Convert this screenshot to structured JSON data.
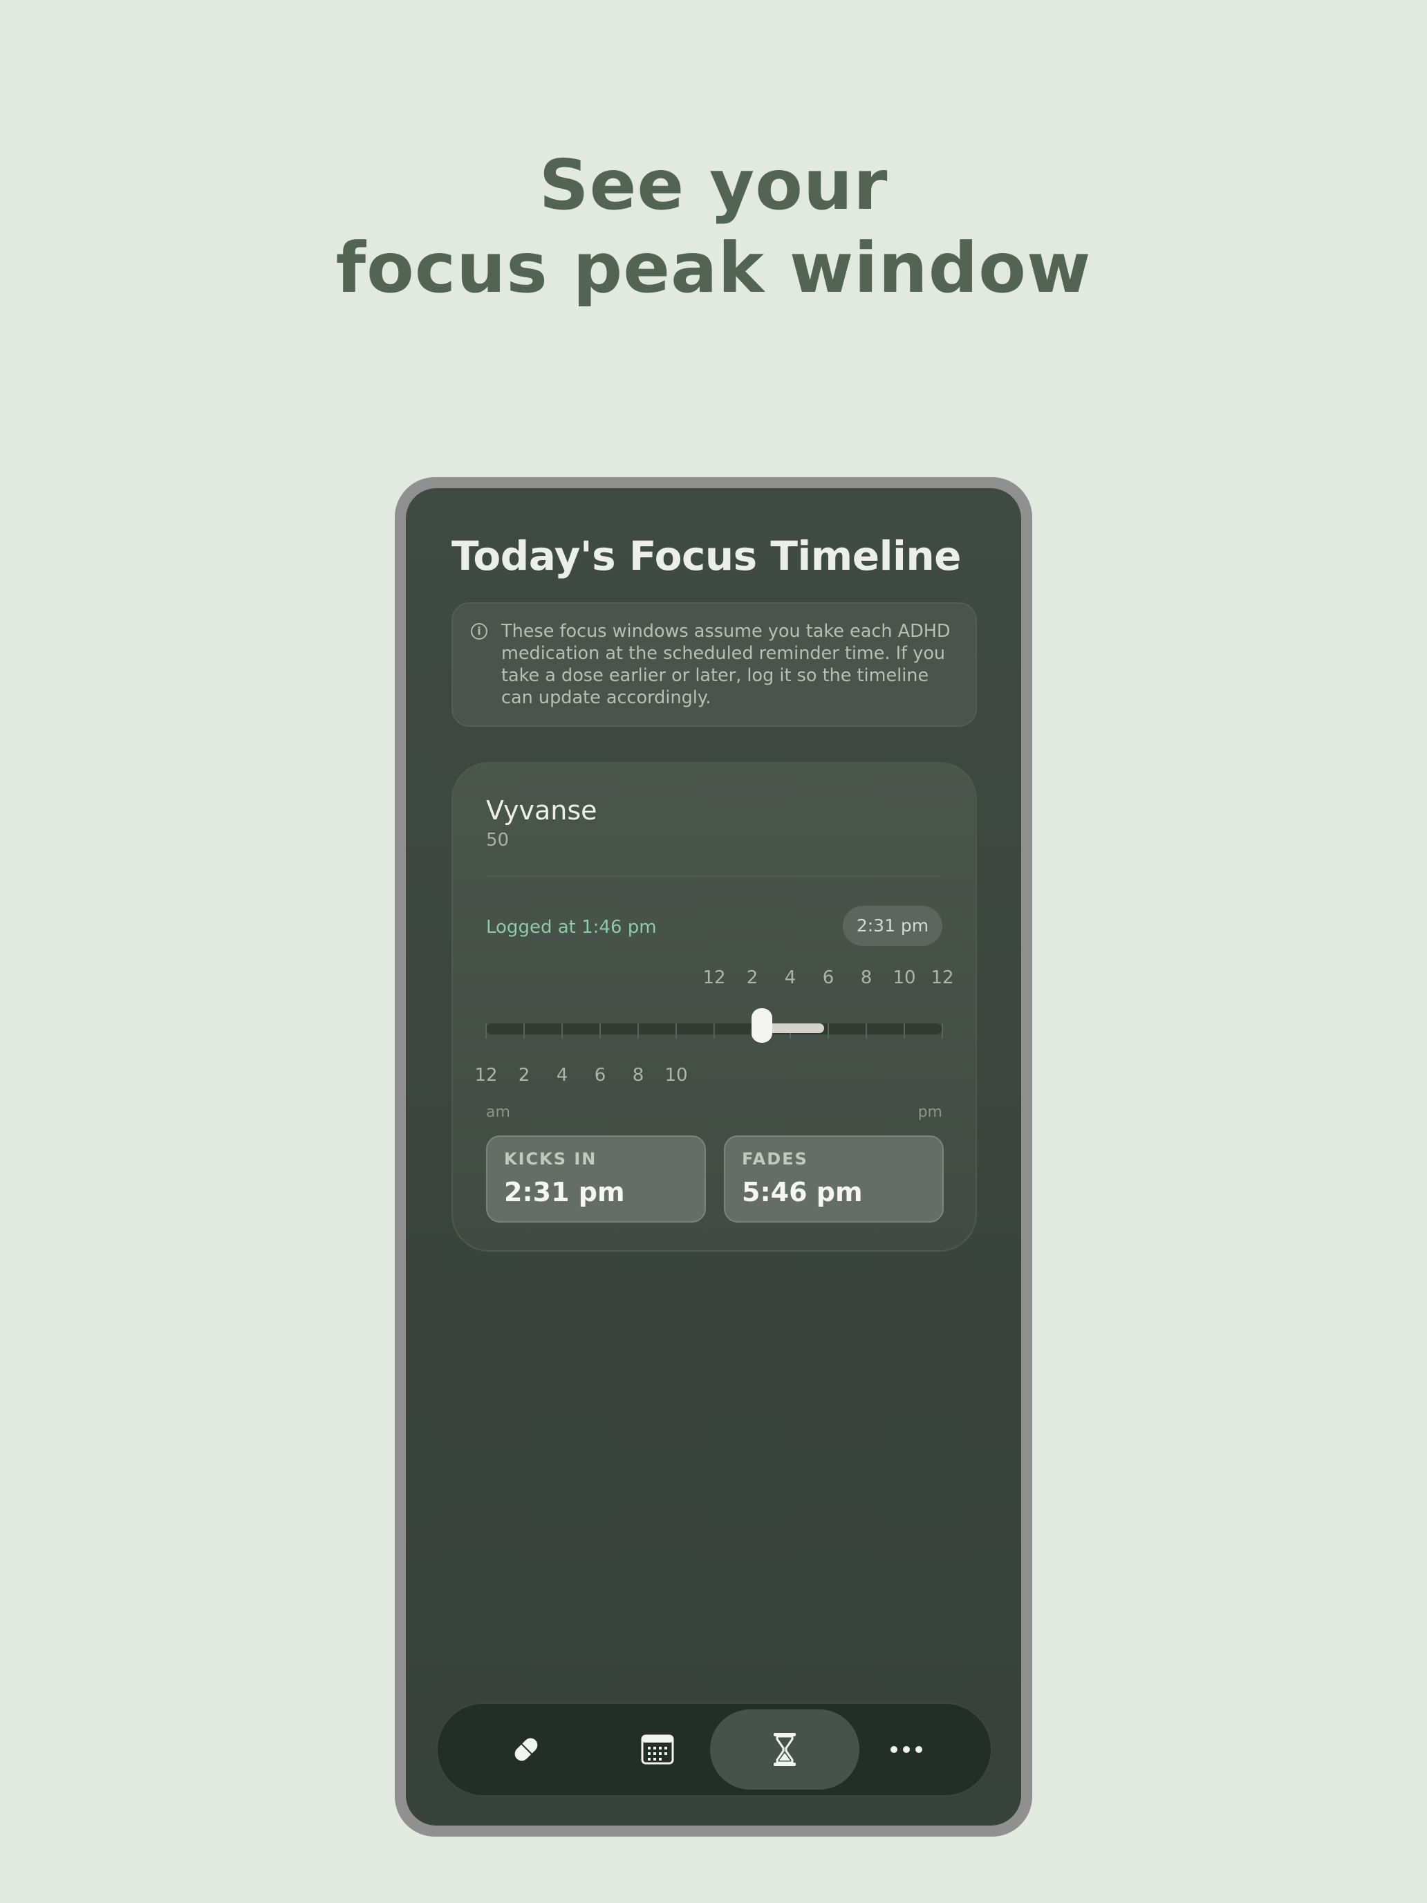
{
  "headline": {
    "line1": "See your",
    "line2": "focus peak window"
  },
  "screen": {
    "title": "Today's Focus Timeline",
    "info": {
      "icon": "info-icon",
      "text": "These focus windows assume you take each ADHD medication at the scheduled reminder time. If you take a dose earlier or later, log it so the timeline can update accordingly."
    },
    "medication": {
      "name": "Vyvanse",
      "dose": "50",
      "logged_text": "Logged at 1:46 pm",
      "current_time": "2:31 pm",
      "timeline": {
        "ticks_am": [
          "12",
          "2",
          "4",
          "6",
          "8",
          "10"
        ],
        "ticks_pm": [
          "12",
          "2",
          "4",
          "6",
          "8",
          "10",
          "12"
        ],
        "am_label": "am",
        "pm_label": "pm",
        "range_hours": [
          0,
          24
        ],
        "current_hour": 14.52,
        "window_start_hour": 14.52,
        "window_end_hour": 17.77
      },
      "kicks_in": {
        "label": "KICKS IN",
        "value": "2:31 pm"
      },
      "fades": {
        "label": "FADES",
        "value": "5:46 pm"
      }
    },
    "tabbar": {
      "tabs": [
        {
          "icon": "pill-icon",
          "active": false
        },
        {
          "icon": "calendar-icon",
          "active": false
        },
        {
          "icon": "hourglass-icon",
          "active": true
        },
        {
          "icon": "more-icon",
          "active": false
        }
      ]
    }
  },
  "colors": {
    "background": "#e2e9de",
    "headline": "#546454",
    "screen": "#3d4740",
    "accent_green": "#8ec9ab"
  }
}
